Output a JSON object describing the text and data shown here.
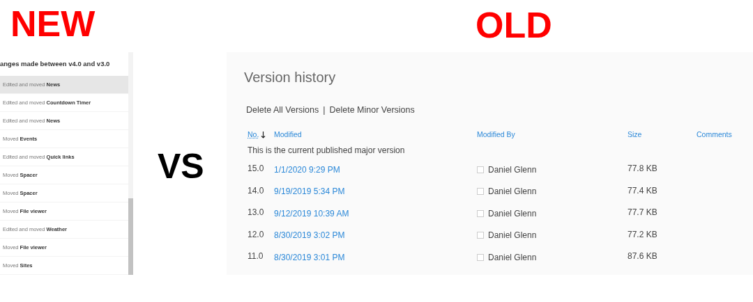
{
  "labels": [
    {
      "text": "NEW",
      "kind": "heading"
    },
    {
      "text": "VS",
      "kind": "separator"
    },
    {
      "text": "OLD",
      "kind": "heading"
    }
  ],
  "new_panel": {
    "title": "anges made between v4.0 and v3.0",
    "items": [
      {
        "text": "Edited and moved **News**",
        "selected": true
      },
      {
        "text": "Edited and moved **Countdown Timer**",
        "selected": false
      },
      {
        "text": "Edited and moved **News**",
        "selected": false
      },
      {
        "text": "Moved **Events**",
        "selected": false
      },
      {
        "text": "Edited and moved **Quick links**",
        "selected": false
      },
      {
        "text": "Moved **Spacer**",
        "selected": false
      },
      {
        "text": "Moved **Spacer**",
        "selected": false
      },
      {
        "text": "Moved **File viewer**",
        "selected": false
      },
      {
        "text": "Edited and moved **Weather**",
        "selected": false
      },
      {
        "text": "Moved **File viewer**",
        "selected": false
      },
      {
        "text": "Moved **Sites**",
        "selected": false
      }
    ]
  },
  "old_panel": {
    "title": "Version history",
    "actions": [
      "Delete All Versions",
      "Delete Minor Versions"
    ],
    "action_separator": "|",
    "table": {
      "columns": [
        "No.",
        "Modified",
        "Modified By",
        "Size",
        "Comments"
      ],
      "note": "This is the current published major version",
      "rows": [
        {
          "no": "15.0",
          "modified": "1/1/2020 9:29 PM",
          "modified_by": "Daniel Glenn",
          "size": "77.8 KB"
        },
        {
          "no": "14.0",
          "modified": "9/19/2019 5:34 PM",
          "modified_by": "Daniel Glenn",
          "size": "77.4 KB"
        },
        {
          "no": "13.0",
          "modified": "9/12/2019 10:39 AM",
          "modified_by": "Daniel Glenn",
          "size": "77.7 KB"
        },
        {
          "no": "12.0",
          "modified": "8/30/2019 3:02 PM",
          "modified_by": "Daniel Glenn",
          "size": "77.2 KB"
        },
        {
          "no": "11.0",
          "modified": "8/30/2019 3:01 PM",
          "modified_by": "Daniel Glenn",
          "size": "87.6 KB"
        }
      ]
    }
  }
}
